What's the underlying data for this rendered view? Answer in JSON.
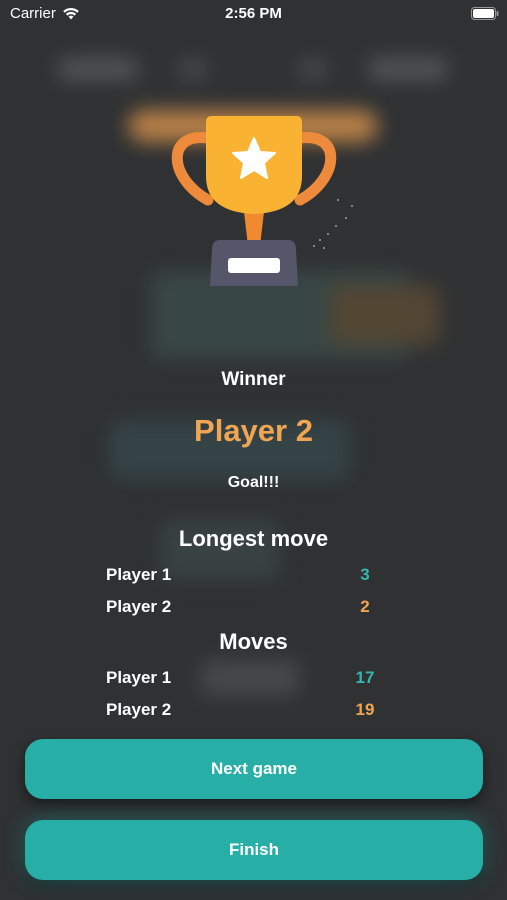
{
  "status_bar": {
    "carrier": "Carrier",
    "time": "2:56 PM",
    "wifi_icon": "wifi-icon",
    "battery_icon": "battery-icon"
  },
  "trophy": {
    "icon": "trophy-icon",
    "star_icon": "star-icon",
    "colors": {
      "cup": "#f9b232",
      "handles": "#ee8a3c",
      "star": "#ffffff",
      "base": "#55566a"
    }
  },
  "result": {
    "winner_label": "Winner",
    "winner_name": "Player 2",
    "reason": "Goal!!!"
  },
  "longest_move": {
    "title": "Longest move",
    "rows": [
      {
        "player": "Player 1",
        "value": "3"
      },
      {
        "player": "Player 2",
        "value": "2"
      }
    ]
  },
  "moves": {
    "title": "Moves",
    "rows": [
      {
        "player": "Player 1",
        "value": "17"
      },
      {
        "player": "Player 2",
        "value": "19"
      }
    ]
  },
  "buttons": {
    "next_game": "Next game",
    "finish": "Finish"
  },
  "colors": {
    "background": "#2f3133",
    "accent_teal": "#27aea6",
    "player1": "#35b8ae",
    "player2": "#f0a553"
  }
}
